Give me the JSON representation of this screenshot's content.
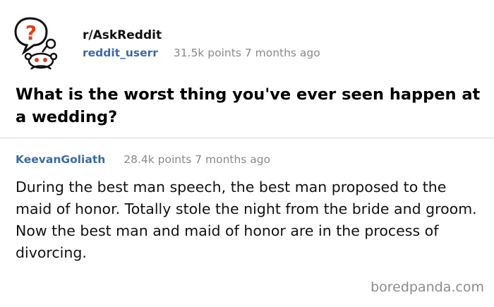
{
  "post": {
    "subreddit": "r/AskReddit",
    "username": "reddit_userr",
    "stats": "31.5k points 7 months ago",
    "title": "What is the worst thing you've ever seen happen at a wedding?"
  },
  "comment": {
    "username": "KeevanGoliath",
    "stats": "28.4k points 7 months ago",
    "body": "During the best man speech, the best man proposed to the maid of honor. Totally stole the night from the bride and groom. Now the best man and maid of honor are in the process of divorcing."
  },
  "icons": {
    "avatar": "reddit-alien-question-icon"
  },
  "colors": {
    "username": "#3a6aa6",
    "meta": "#8a8a8a",
    "question_mark": "#e0401b"
  },
  "watermark": "boredpanda.com"
}
